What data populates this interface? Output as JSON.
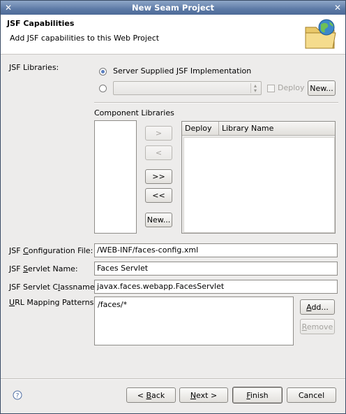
{
  "window": {
    "title": "New Seam Project"
  },
  "header": {
    "title": "JSF Capabilities",
    "description": "Add JSF capabilities to this Web Project"
  },
  "libraries": {
    "label": "JSF Libraries:",
    "server_supplied_label": "Server Supplied JSF Implementation",
    "server_supplied_selected": true,
    "custom_selected": false,
    "custom_combo_value": "",
    "deploy_label": "Deploy",
    "deploy_checked": false,
    "new_button": "New..."
  },
  "component_libraries": {
    "label": "Component Libraries",
    "buttons": {
      "add": ">",
      "remove": "<",
      "add_all": ">>",
      "remove_all": "<<",
      "new": "New..."
    },
    "table_headers": [
      "Deploy",
      "Library Name"
    ]
  },
  "config": {
    "config_file_label_pre": "JSF ",
    "config_file_label_ul": "C",
    "config_file_label_post": "onfiguration File:",
    "config_file_value": "/WEB-INF/faces-config.xml",
    "servlet_name_label_pre": "JSF ",
    "servlet_name_label_ul": "S",
    "servlet_name_label_post": "ervlet Name:",
    "servlet_name_value": "Faces Servlet",
    "servlet_class_label_pre": "JSF Servlet C",
    "servlet_class_label_ul": "l",
    "servlet_class_label_post": "assname:",
    "servlet_class_value": "javax.faces.webapp.FacesServlet",
    "url_label_ul": "U",
    "url_label_post": "RL Mapping Patterns:",
    "url_patterns": [
      "/faces/*"
    ],
    "add_button_ul": "A",
    "add_button_post": "dd...",
    "remove_button_ul": "R",
    "remove_button_post": "emove"
  },
  "footer": {
    "help_icon": "help-icon",
    "back_pre": "< ",
    "back_ul": "B",
    "back_post": "ack",
    "next_ul": "N",
    "next_post": "ext >",
    "finish_ul": "F",
    "finish_post": "inish",
    "cancel": "Cancel"
  }
}
